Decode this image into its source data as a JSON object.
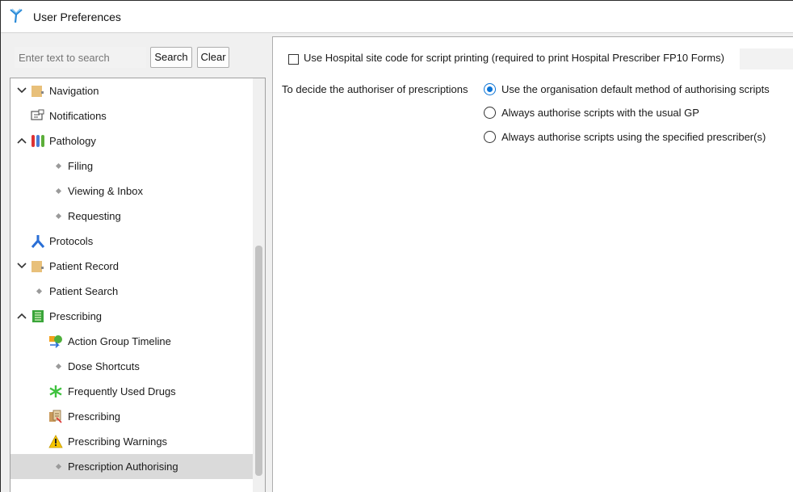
{
  "window": {
    "title": "User Preferences"
  },
  "search": {
    "placeholder": "Enter text to search",
    "search_label": "Search",
    "clear_label": "Clear"
  },
  "tree": {
    "items": [
      {
        "label": "Navigation"
      },
      {
        "label": "Notifications"
      },
      {
        "label": "Pathology"
      },
      {
        "label": "Filing"
      },
      {
        "label": "Viewing & Inbox"
      },
      {
        "label": "Requesting"
      },
      {
        "label": "Protocols"
      },
      {
        "label": "Patient Record"
      },
      {
        "label": "Patient Search"
      },
      {
        "label": "Prescribing"
      },
      {
        "label": "Action Group Timeline"
      },
      {
        "label": "Dose Shortcuts"
      },
      {
        "label": "Frequently Used Drugs"
      },
      {
        "label": "Prescribing"
      },
      {
        "label": "Prescribing Warnings"
      },
      {
        "label": "Prescription Authorising"
      }
    ],
    "selected": "Prescription Authorising"
  },
  "settings": {
    "hospital_checkbox": {
      "label": "Use Hospital site code for script printing (required to print Hospital Prescriber FP10 Forms)",
      "checked": false
    },
    "authoriser": {
      "label": "To decide the authoriser of prescriptions",
      "options": [
        {
          "label": "Use the organisation default method of authorising scripts",
          "selected": true
        },
        {
          "label": "Always authorise scripts with the usual GP",
          "selected": false
        },
        {
          "label": "Always authorise scripts using the specified prescriber(s)",
          "selected": false
        }
      ]
    }
  },
  "colors": {
    "accent": "#0a73d6",
    "selection": "#dadada"
  }
}
